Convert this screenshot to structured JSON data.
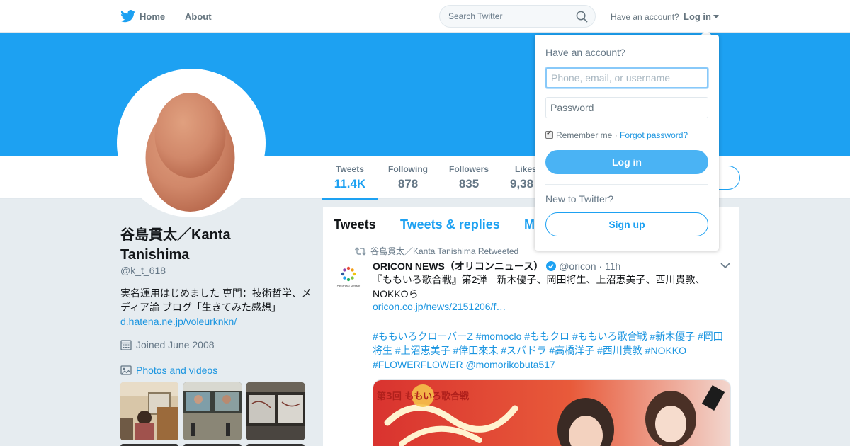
{
  "nav": {
    "home_label": "Home",
    "about_label": "About",
    "search_placeholder": "Search Twitter",
    "have_account": "Have an account?",
    "login_label": "Log in"
  },
  "colors": {
    "brand": "#1da1f2",
    "link": "#1b95e0",
    "banner": "#1da1f2",
    "background": "#e6ecf0"
  },
  "stats": [
    {
      "label": "Tweets",
      "value": "11.4K"
    },
    {
      "label": "Following",
      "value": "878"
    },
    {
      "label": "Followers",
      "value": "835"
    },
    {
      "label": "Likes",
      "value": "9,38"
    }
  ],
  "profile": {
    "name": "谷島貫太／Kanta Tanishima",
    "handle": "@k_t_618",
    "bio_text": "実名運用はじめました 専門：技術哲学、メディア論 ブログ「生きてみた感想」",
    "bio_link": "d.hatena.ne.jp/voleurknkn/",
    "joined": "Joined June 2008",
    "photos_label": "Photos and videos"
  },
  "timeline": {
    "tabs": [
      "Tweets",
      "Tweets & replies",
      "M"
    ],
    "tweet": {
      "retweet_context": "谷島貫太／Kanta Tanishima Retweeted",
      "author_name": "ORICON NEWS（オリコンニュース）",
      "author_handle": "@oricon",
      "time": "11h",
      "text": "『ももいろ歌合戦』第2弾　新木優子、岡田将生、上沼恵美子、西川貴教、NOKKOら",
      "url": "oricon.co.jp/news/2151206/f…",
      "hashtags": "#ももいろクローバーZ #momoclo #ももクロ #ももいろ歌合戦 #新木優子 #岡田将生 #上沼恵美子 #倖田來未 #スバドラ #高橋洋子 #西川貴教 #NOKKO #FLOWERFLOWER @momorikobuta517",
      "avatar_caption": "ORICON NEWS",
      "media_caption": "第3回 ももいろ歌合戦"
    }
  },
  "login_dropdown": {
    "title": "Have an account?",
    "username_placeholder": "Phone, email, or username",
    "password_placeholder": "Password",
    "remember_label": "Remember me",
    "separator": "·",
    "forgot_label": "Forgot password?",
    "login_button": "Log in",
    "new_to_twitter": "New to Twitter?",
    "signup_button": "Sign up"
  }
}
